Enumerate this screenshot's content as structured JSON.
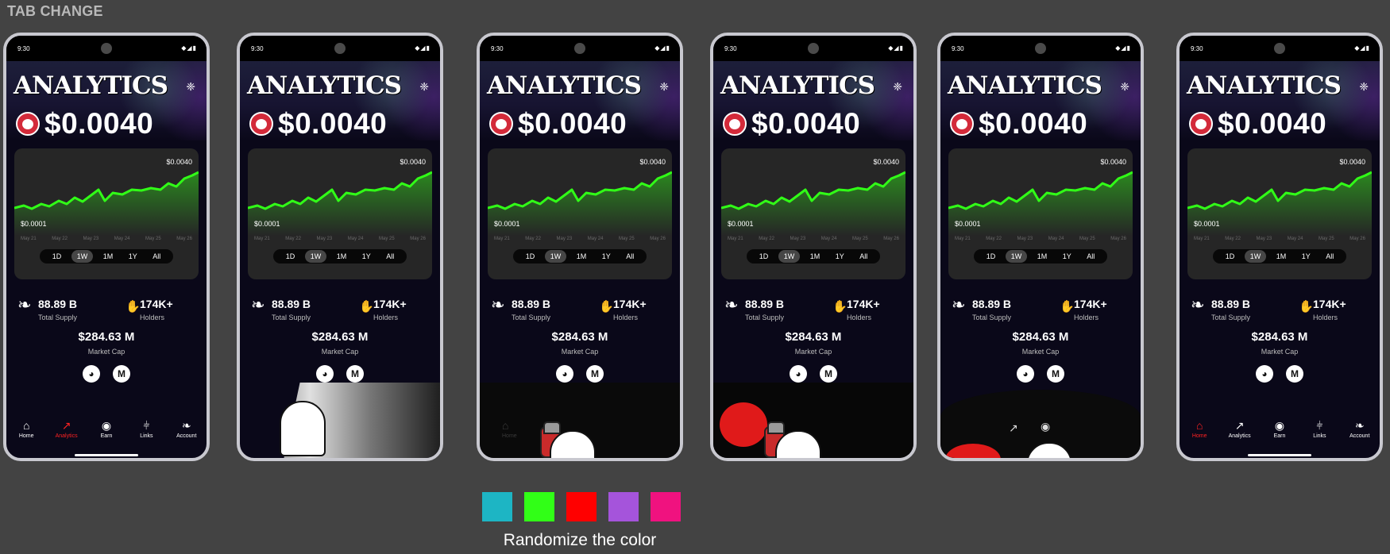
{
  "page_title": "TAB CHANGE",
  "status": {
    "time": "9:30",
    "icons": "◆◢▮"
  },
  "screen": {
    "title": "ANALYTICS",
    "price": "$0.0040",
    "chart": {
      "max_label": "$0.0040",
      "min_label": "$0.0001",
      "dates": [
        "May 21",
        "May 22",
        "May 23",
        "May 24",
        "May 25",
        "May 26"
      ],
      "ranges": [
        "1D",
        "1W",
        "1M",
        "1Y",
        "All"
      ],
      "selected_range": "1W"
    },
    "stats": {
      "supply_value": "88.89 B",
      "supply_label": "Total Supply",
      "holders_value": "174K+",
      "holders_label": "Holders",
      "cap_value": "$284.63 M",
      "cap_label": "Market Cap"
    },
    "nav": [
      "Home",
      "Analytics",
      "Earn",
      "Links",
      "Account"
    ],
    "nav_icons": [
      "cat-home-icon",
      "trend-arrow-icon",
      "coin-icon",
      "bottle-icon",
      "cat-face-icon"
    ]
  },
  "frames": [
    {
      "active_nav": "Analytics",
      "overlay": "none"
    },
    {
      "active_nav": "",
      "overlay": "hand-sweep"
    },
    {
      "active_nav": "",
      "overlay": "spray-can"
    },
    {
      "active_nav": "",
      "overlay": "spray-paint"
    },
    {
      "active_nav": "",
      "overlay": "curved-sweep"
    },
    {
      "active_nav": "Home",
      "overlay": "none"
    }
  ],
  "colors": {
    "accent_green": "#31ff17",
    "active_red": "#ff2222",
    "swatches": [
      "#1db5c4",
      "#31ff17",
      "#ff0000",
      "#a554db",
      "#f0127f"
    ]
  },
  "swatch_caption": "Randomize the color"
}
